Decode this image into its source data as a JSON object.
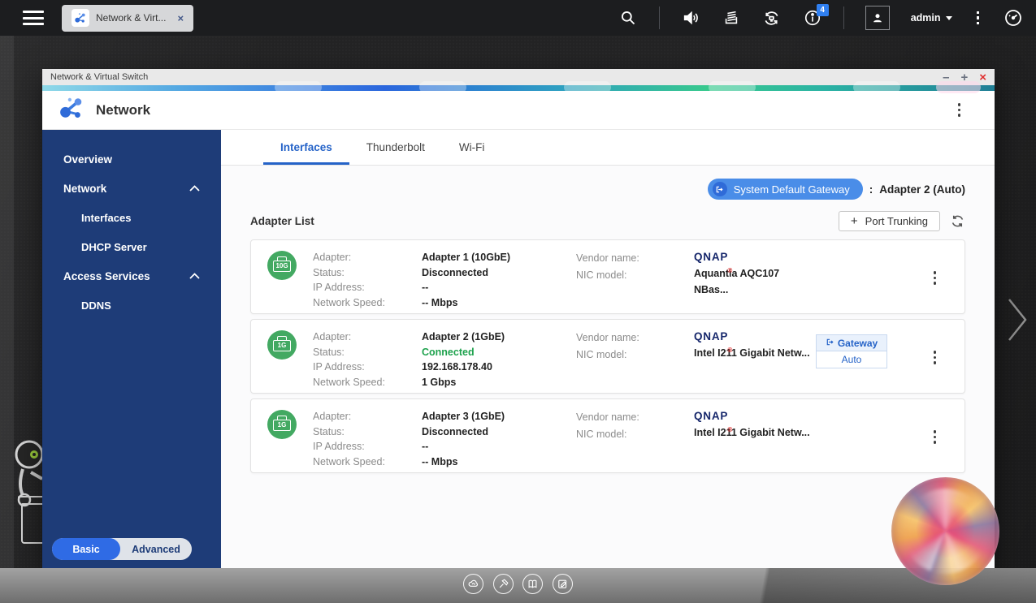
{
  "topbar": {
    "tab": {
      "label": "Network & Virt...",
      "close_glyph": "×"
    },
    "icons": [
      "search-icon",
      "volume-icon",
      "background-tasks-icon",
      "sync-icon",
      "notifications-icon",
      "user-icon",
      "more-icon",
      "dashboard-icon"
    ],
    "notification_badge": "4",
    "user_label": "admin"
  },
  "window": {
    "title": "Network & Virtual Switch",
    "controls": {
      "minimize": "–",
      "maximize": "+",
      "close": "×"
    },
    "header_title": "Network"
  },
  "sidebar": {
    "items": {
      "overview": "Overview",
      "network": "Network",
      "interfaces": "Interfaces",
      "dhcp": "DHCP Server",
      "access": "Access Services",
      "ddns": "DDNS"
    },
    "toggle": {
      "basic": "Basic",
      "advanced": "Advanced"
    }
  },
  "tabs": {
    "interfaces": "Interfaces",
    "thunderbolt": "Thunderbolt",
    "wifi": "Wi-Fi"
  },
  "gateway": {
    "button": "System Default Gateway",
    "separator": ":",
    "value": "Adapter 2 (Auto)"
  },
  "list": {
    "title": "Adapter List",
    "plus": "+",
    "port_trunking": "Port Trunking",
    "labels": {
      "adapter": "Adapter:",
      "status": "Status:",
      "ip": "IP Address:",
      "speed": "Network Speed:",
      "vendor": "Vendor name:",
      "nic": "NIC model:"
    },
    "vendor_logo": "QNAP",
    "adapters": [
      {
        "port": "10G",
        "name": "Adapter 1 (10GbE)",
        "status": "Disconnected",
        "status_color": "#222222",
        "ip": "--",
        "speed": "-- Mbps",
        "nic": "Aquantia AQC107 NBas...",
        "gateway_label": "",
        "gateway_mode": ""
      },
      {
        "port": "1G",
        "name": "Adapter 2 (1GbE)",
        "status": "Connected",
        "status_color": "#1ea24d",
        "ip": "192.168.178.40",
        "speed": "1 Gbps",
        "nic": "Intel I211 Gigabit Netw...",
        "gateway_label": "Gateway",
        "gateway_mode": "Auto"
      },
      {
        "port": "1G",
        "name": "Adapter 3 (1GbE)",
        "status": "Disconnected",
        "status_color": "#222222",
        "ip": "--",
        "speed": "-- Mbps",
        "nic": "Intel I211 Gigabit Netw...",
        "gateway_label": "",
        "gateway_mode": ""
      }
    ]
  },
  "dock": {
    "icons": [
      "cloud-icon",
      "tools-icon",
      "book-icon",
      "notes-icon"
    ]
  },
  "colors": {
    "sidebar_blue": "#1e3c78",
    "accent_blue": "#2563c8",
    "gateway_button_blue": "#4a8de8",
    "connected_green": "#1ea24d",
    "port_green": "#43a962",
    "close_red": "#e03030",
    "badge_blue": "#2f7ff0"
  }
}
